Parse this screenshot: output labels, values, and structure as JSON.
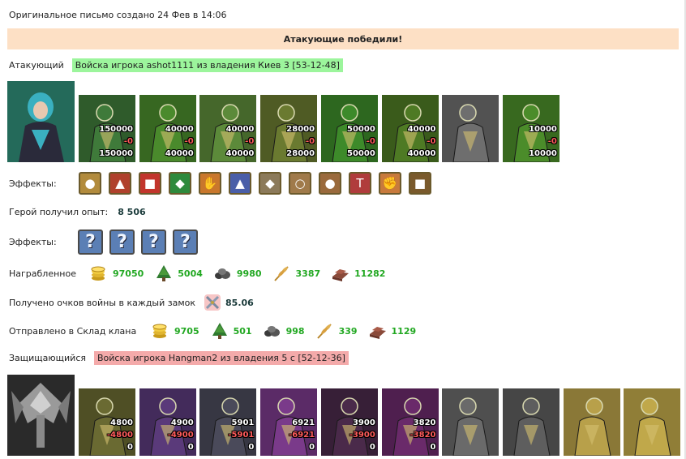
{
  "header": {
    "created_text": "Оригинальное письмо создано 24 Фев в 14:06"
  },
  "banner": {
    "text": "Атакующие победили!"
  },
  "attacker": {
    "label": "Атакующий",
    "tag": "Войска игрока ashot1111 из владения Киев 3 [53-12-48]",
    "units": [
      {
        "name": "unit-green-rider",
        "count": "150000",
        "loss": "-0",
        "remain": "150000",
        "color": "#3f7a3a"
      },
      {
        "name": "unit-green-swordsman",
        "count": "40000",
        "loss": "-0",
        "remain": "40000",
        "color": "#4a8a2c"
      },
      {
        "name": "unit-green-spearman",
        "count": "40000",
        "loss": "-0",
        "remain": "40000",
        "color": "#5c8a3a"
      },
      {
        "name": "unit-winged-creature",
        "count": "28000",
        "loss": "-0",
        "remain": "28000",
        "color": "#6a7a30"
      },
      {
        "name": "unit-green-archer",
        "count": "50000",
        "loss": "-0",
        "remain": "50000",
        "color": "#3d8a2a"
      },
      {
        "name": "unit-green-knight",
        "count": "40000",
        "loss": "-0",
        "remain": "40000",
        "color": "#4e7a24"
      },
      {
        "name": "unit-grey-hooded",
        "count": "",
        "loss": "",
        "remain": "",
        "color": "#6e6e6e"
      },
      {
        "name": "unit-green-mage",
        "count": "10000",
        "loss": "-0",
        "remain": "10000",
        "color": "#4b8c2a"
      }
    ]
  },
  "effects1": {
    "label": "Эффекты:",
    "items": [
      {
        "icon": "coins-effect-icon",
        "glyph": "●",
        "color": "#b28b3c"
      },
      {
        "icon": "castle-effect-icon",
        "glyph": "▲",
        "color": "#b0412c"
      },
      {
        "icon": "dice-effect-icon",
        "glyph": "■",
        "color": "#c2352c"
      },
      {
        "icon": "shield-effect-icon",
        "glyph": "◆",
        "color": "#2e8a3c"
      },
      {
        "icon": "handshake-effect-icon",
        "glyph": "✋",
        "color": "#c9772c"
      },
      {
        "icon": "helmet-effect-icon",
        "glyph": "▲",
        "color": "#4a5ea8"
      },
      {
        "icon": "armor-effect-icon",
        "glyph": "◆",
        "color": "#8c7a5a"
      },
      {
        "icon": "bracelet-effect-icon",
        "glyph": "○",
        "color": "#a07a4a"
      },
      {
        "icon": "sack-effect-icon",
        "glyph": "●",
        "color": "#9a6a3c"
      },
      {
        "icon": "hammer-effect-icon",
        "glyph": "T",
        "color": "#b03c3c"
      },
      {
        "icon": "fist-effect-icon",
        "glyph": "✊",
        "color": "#c87a3c"
      },
      {
        "icon": "chest-effect-icon",
        "glyph": "■",
        "color": "#7a5a2c"
      }
    ]
  },
  "experience": {
    "label": "Герой получил опыт:",
    "value": "8 506"
  },
  "effects2": {
    "label": "Эффекты:",
    "items": [
      "?",
      "?",
      "?",
      "?"
    ]
  },
  "loot": {
    "label": "Награбленное",
    "items": [
      {
        "icon": "gold-icon",
        "value": "97050"
      },
      {
        "icon": "wood-icon",
        "value": "5004"
      },
      {
        "icon": "ore-icon",
        "value": "9980"
      },
      {
        "icon": "grain-icon",
        "value": "3387"
      },
      {
        "icon": "brick-icon",
        "value": "11282"
      }
    ]
  },
  "war_points": {
    "label": "Получено очков войны в каждый замок",
    "value": "85.06"
  },
  "clan_storage": {
    "label": "Отправлено в Склад клана",
    "items": [
      {
        "icon": "gold-icon",
        "value": "9705"
      },
      {
        "icon": "wood-icon",
        "value": "501"
      },
      {
        "icon": "ore-icon",
        "value": "998"
      },
      {
        "icon": "grain-icon",
        "value": "339"
      },
      {
        "icon": "brick-icon",
        "value": "1129"
      }
    ]
  },
  "defender": {
    "label": "Защищающийся",
    "tag": "Войска игрока Hangman2 из владения 5 с [52-12-36]",
    "units": [
      {
        "name": "unit-green-ogre",
        "count": "4800",
        "loss": "-4800",
        "remain": "0",
        "color": "#6a6a32"
      },
      {
        "name": "unit-purple-rogue",
        "count": "4900",
        "loss": "-4900",
        "remain": "0",
        "color": "#5a3a7a"
      },
      {
        "name": "unit-dragon-rider",
        "count": "5901",
        "loss": "-5901",
        "remain": "0",
        "color": "#4a4a5a"
      },
      {
        "name": "unit-purple-harpy",
        "count": "6921",
        "loss": "-6921",
        "remain": "0",
        "color": "#7a3a8a"
      },
      {
        "name": "unit-dark-archer",
        "count": "3900",
        "loss": "-3900",
        "remain": "0",
        "color": "#4a2a4a"
      },
      {
        "name": "unit-purple-sorceress",
        "count": "3820",
        "loss": "-3820",
        "remain": "0",
        "color": "#6a2a6a"
      },
      {
        "name": "unit-grey-hooded-2",
        "count": "",
        "loss": "",
        "remain": "",
        "color": "#6a6a6a"
      },
      {
        "name": "unit-grey-spider",
        "count": "",
        "loss": "",
        "remain": "",
        "color": "#5e5e5e"
      },
      {
        "name": "unit-golden-lizard",
        "count": "",
        "loss": "",
        "remain": "",
        "color": "#b8a04a"
      },
      {
        "name": "unit-golden-orb",
        "count": "",
        "loss": "",
        "remain": "",
        "color": "#c0a84a"
      }
    ]
  }
}
